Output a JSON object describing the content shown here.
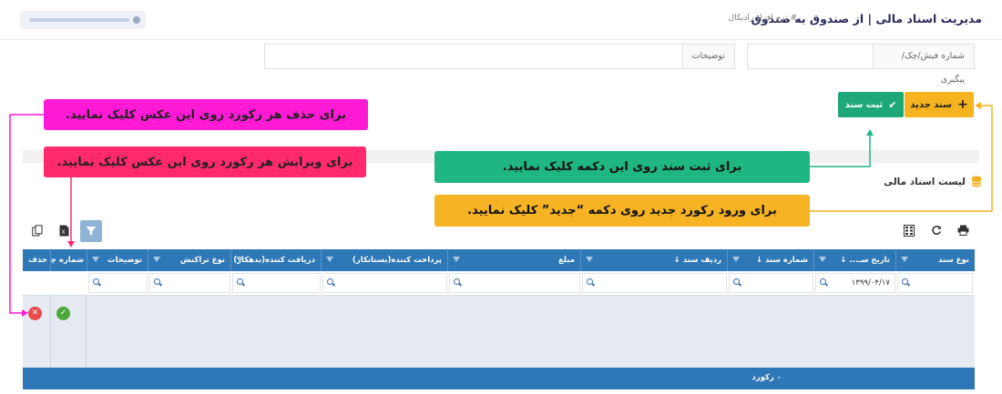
{
  "header": {
    "title": "مدیریت اسناد مالی | از صندوق به صندوق",
    "breadcrumb": "# نرم افزار رادیکال"
  },
  "filters": {
    "receipt_label": "شماره فیش/چک/پیگیری",
    "description_label": "توضیحات"
  },
  "toolbar": {
    "new_label": "سند جدید",
    "save_label": "ثبت سند"
  },
  "callouts": {
    "delete": "برای حذف هر رکورد روی این عکس کلیک نمایید.",
    "edit": "برای ویرایش هر رکورد روی این عکس کلیک نمایید.",
    "save": "برای ثبت سند روی این دکمه کلیک نمایید.",
    "new": "برای ورود رکورد جدید روی دکمه “جدید” کلیک نمایید."
  },
  "list": {
    "title": "لیست اسناد مالی"
  },
  "grid": {
    "columns": [
      "نوع سند",
      "تاریخ سـ... ↓",
      "شماره سند ↓",
      "ردیف سند ↓",
      "مبلغ",
      "پرداخت کننده(بستانکار)",
      "دریافت کننده(بدهکار)",
      "نوع تراکنش",
      "توضیحات",
      "شماره چک",
      "ویرایش",
      "حذف"
    ],
    "date_filter_value": "۱۳۹۹/۰۴/۱۷",
    "footer": "۰ رکورد"
  },
  "colors": {
    "primary": "#2f78b7",
    "new_button": "#f5b41f",
    "save_button": "#1fa877",
    "callout_delete": "#ff1ad6",
    "callout_edit": "#ff2a6e",
    "callout_save": "#1fb681",
    "callout_new": "#f6b323"
  }
}
